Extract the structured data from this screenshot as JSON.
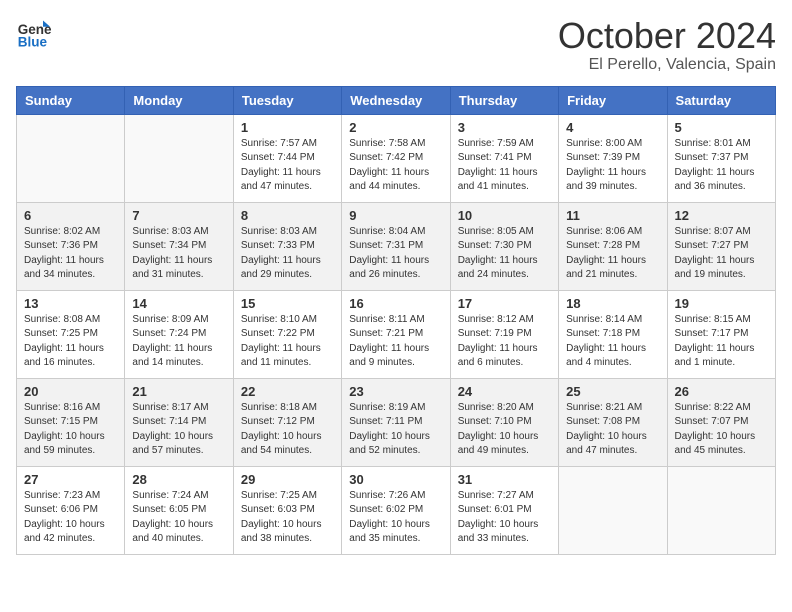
{
  "header": {
    "logo_line1": "General",
    "logo_line2": "Blue",
    "month": "October 2024",
    "location": "El Perello, Valencia, Spain"
  },
  "days_of_week": [
    "Sunday",
    "Monday",
    "Tuesday",
    "Wednesday",
    "Thursday",
    "Friday",
    "Saturday"
  ],
  "weeks": [
    [
      {
        "day": "",
        "info": ""
      },
      {
        "day": "",
        "info": ""
      },
      {
        "day": "1",
        "info": "Sunrise: 7:57 AM\nSunset: 7:44 PM\nDaylight: 11 hours and 47 minutes."
      },
      {
        "day": "2",
        "info": "Sunrise: 7:58 AM\nSunset: 7:42 PM\nDaylight: 11 hours and 44 minutes."
      },
      {
        "day": "3",
        "info": "Sunrise: 7:59 AM\nSunset: 7:41 PM\nDaylight: 11 hours and 41 minutes."
      },
      {
        "day": "4",
        "info": "Sunrise: 8:00 AM\nSunset: 7:39 PM\nDaylight: 11 hours and 39 minutes."
      },
      {
        "day": "5",
        "info": "Sunrise: 8:01 AM\nSunset: 7:37 PM\nDaylight: 11 hours and 36 minutes."
      }
    ],
    [
      {
        "day": "6",
        "info": "Sunrise: 8:02 AM\nSunset: 7:36 PM\nDaylight: 11 hours and 34 minutes."
      },
      {
        "day": "7",
        "info": "Sunrise: 8:03 AM\nSunset: 7:34 PM\nDaylight: 11 hours and 31 minutes."
      },
      {
        "day": "8",
        "info": "Sunrise: 8:03 AM\nSunset: 7:33 PM\nDaylight: 11 hours and 29 minutes."
      },
      {
        "day": "9",
        "info": "Sunrise: 8:04 AM\nSunset: 7:31 PM\nDaylight: 11 hours and 26 minutes."
      },
      {
        "day": "10",
        "info": "Sunrise: 8:05 AM\nSunset: 7:30 PM\nDaylight: 11 hours and 24 minutes."
      },
      {
        "day": "11",
        "info": "Sunrise: 8:06 AM\nSunset: 7:28 PM\nDaylight: 11 hours and 21 minutes."
      },
      {
        "day": "12",
        "info": "Sunrise: 8:07 AM\nSunset: 7:27 PM\nDaylight: 11 hours and 19 minutes."
      }
    ],
    [
      {
        "day": "13",
        "info": "Sunrise: 8:08 AM\nSunset: 7:25 PM\nDaylight: 11 hours and 16 minutes."
      },
      {
        "day": "14",
        "info": "Sunrise: 8:09 AM\nSunset: 7:24 PM\nDaylight: 11 hours and 14 minutes."
      },
      {
        "day": "15",
        "info": "Sunrise: 8:10 AM\nSunset: 7:22 PM\nDaylight: 11 hours and 11 minutes."
      },
      {
        "day": "16",
        "info": "Sunrise: 8:11 AM\nSunset: 7:21 PM\nDaylight: 11 hours and 9 minutes."
      },
      {
        "day": "17",
        "info": "Sunrise: 8:12 AM\nSunset: 7:19 PM\nDaylight: 11 hours and 6 minutes."
      },
      {
        "day": "18",
        "info": "Sunrise: 8:14 AM\nSunset: 7:18 PM\nDaylight: 11 hours and 4 minutes."
      },
      {
        "day": "19",
        "info": "Sunrise: 8:15 AM\nSunset: 7:17 PM\nDaylight: 11 hours and 1 minute."
      }
    ],
    [
      {
        "day": "20",
        "info": "Sunrise: 8:16 AM\nSunset: 7:15 PM\nDaylight: 10 hours and 59 minutes."
      },
      {
        "day": "21",
        "info": "Sunrise: 8:17 AM\nSunset: 7:14 PM\nDaylight: 10 hours and 57 minutes."
      },
      {
        "day": "22",
        "info": "Sunrise: 8:18 AM\nSunset: 7:12 PM\nDaylight: 10 hours and 54 minutes."
      },
      {
        "day": "23",
        "info": "Sunrise: 8:19 AM\nSunset: 7:11 PM\nDaylight: 10 hours and 52 minutes."
      },
      {
        "day": "24",
        "info": "Sunrise: 8:20 AM\nSunset: 7:10 PM\nDaylight: 10 hours and 49 minutes."
      },
      {
        "day": "25",
        "info": "Sunrise: 8:21 AM\nSunset: 7:08 PM\nDaylight: 10 hours and 47 minutes."
      },
      {
        "day": "26",
        "info": "Sunrise: 8:22 AM\nSunset: 7:07 PM\nDaylight: 10 hours and 45 minutes."
      }
    ],
    [
      {
        "day": "27",
        "info": "Sunrise: 7:23 AM\nSunset: 6:06 PM\nDaylight: 10 hours and 42 minutes."
      },
      {
        "day": "28",
        "info": "Sunrise: 7:24 AM\nSunset: 6:05 PM\nDaylight: 10 hours and 40 minutes."
      },
      {
        "day": "29",
        "info": "Sunrise: 7:25 AM\nSunset: 6:03 PM\nDaylight: 10 hours and 38 minutes."
      },
      {
        "day": "30",
        "info": "Sunrise: 7:26 AM\nSunset: 6:02 PM\nDaylight: 10 hours and 35 minutes."
      },
      {
        "day": "31",
        "info": "Sunrise: 7:27 AM\nSunset: 6:01 PM\nDaylight: 10 hours and 33 minutes."
      },
      {
        "day": "",
        "info": ""
      },
      {
        "day": "",
        "info": ""
      }
    ]
  ]
}
